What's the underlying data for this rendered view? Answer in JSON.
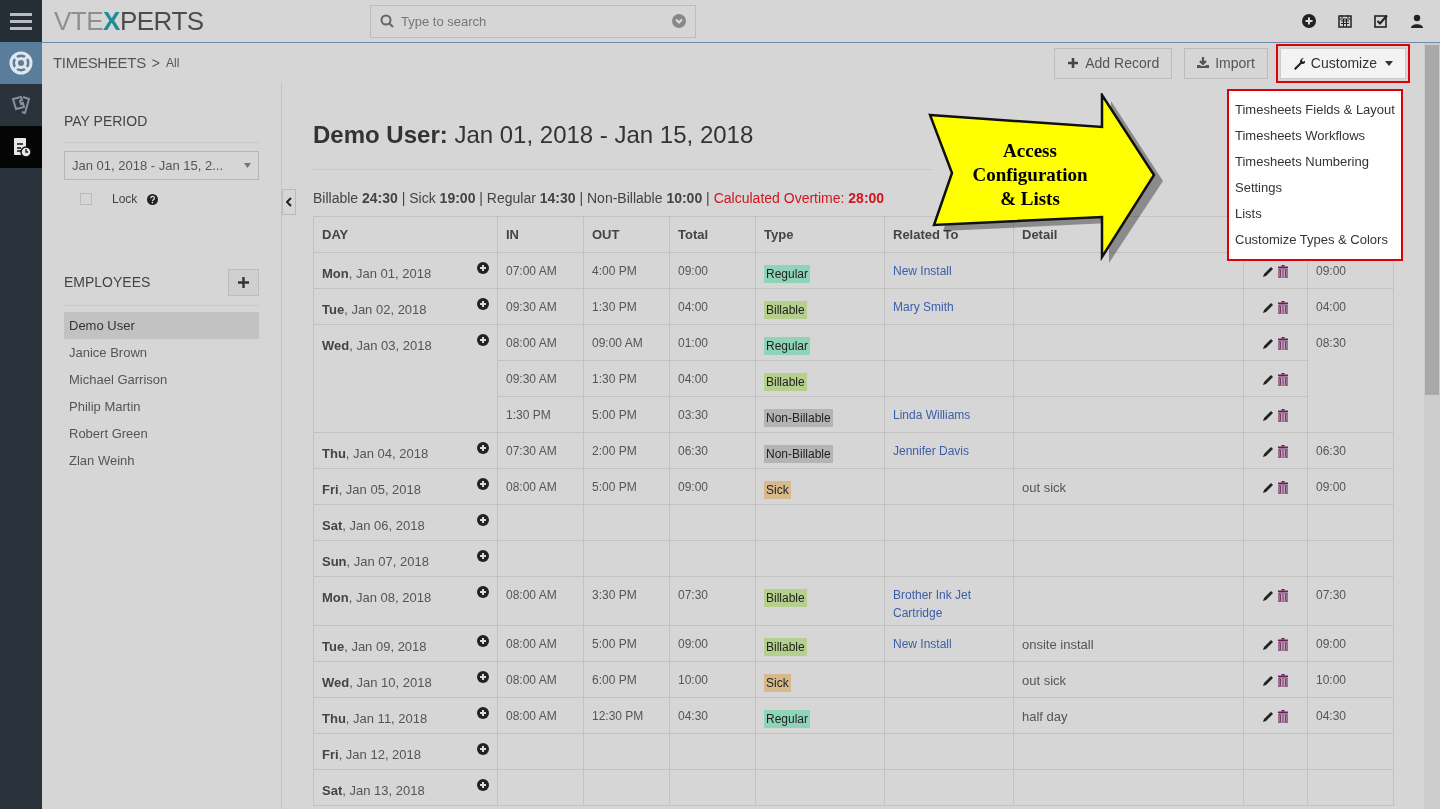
{
  "nav_rail": [
    {
      "selected": false
    },
    {
      "selected": false
    },
    {
      "selected": true
    }
  ],
  "logo": {
    "part_1": "VTE",
    "part_2": "X",
    "part_3": "PERTS"
  },
  "search": {
    "placeholder": "Type to search"
  },
  "breadcrumb": {
    "module": "TIMESHEETS",
    "separator": ">",
    "view": "All"
  },
  "toolbar": {
    "buttons": [
      {
        "label": "Add Record",
        "kind": "add",
        "highlighted": false
      },
      {
        "label": "Import",
        "kind": "import",
        "highlighted": false
      },
      {
        "label": "Customize",
        "kind": "customize",
        "highlighted": true
      }
    ]
  },
  "customize_menu": {
    "items": [
      "Timesheets Fields & Layout",
      "Timesheets Workflows",
      "Timesheets Numbering",
      "Settings",
      "Lists",
      "Customize Types & Colors"
    ]
  },
  "pay_period": {
    "heading": "PAY PERIOD",
    "value": "Jan 01, 2018 - Jan 15, 2...",
    "lock": {
      "label": "Lock",
      "checked": false
    }
  },
  "employees": {
    "heading": "EMPLOYEES",
    "items": [
      {
        "name": "Demo User",
        "selected": true
      },
      {
        "name": "Janice Brown",
        "selected": false
      },
      {
        "name": "Michael Garrison",
        "selected": false
      },
      {
        "name": "Philip Martin",
        "selected": false
      },
      {
        "name": "Robert Green",
        "selected": false
      },
      {
        "name": "Zlan Weinh",
        "selected": false
      }
    ]
  },
  "title": "**Demo User:** Jan 01, 2018 - Jan 15, 2018",
  "summary": "Billable **24:30** | Sick **19:00** | Regular **14:30** | Non-Billable **10:00** |",
  "overtime": "Calculated Overtime: **28:00**",
  "table": {
    "columns": [
      "DAY",
      "IN",
      "OUT",
      "Total",
      "Type",
      "Related To",
      "Detail"
    ],
    "days": [
      {
        "weekday": "Mon",
        "date": ", Jan 01, 2018",
        "total": "09:00",
        "entries": [
          {
            "in": "07:00 AM",
            "out": "4:00 PM",
            "total": "09:00",
            "type": "Regular",
            "color": "#8fd3b8",
            "related": "New Install"
          }
        ]
      },
      {
        "weekday": "Tue",
        "date": ", Jan 02, 2018",
        "total": "04:00",
        "entries": [
          {
            "in": "09:30 AM",
            "out": "1:30 PM",
            "total": "04:00",
            "type": "Billable",
            "color": "#b5cf8c",
            "related": "Mary Smith"
          }
        ]
      },
      {
        "weekday": "Wed",
        "date": ", Jan 03, 2018",
        "total": "08:30",
        "entries": [
          {
            "in": "08:00 AM",
            "out": "09:00 AM",
            "total": "01:00",
            "type": "Regular",
            "color": "#8fd3b8"
          },
          {
            "in": "09:30 AM",
            "out": "1:30 PM",
            "total": "04:00",
            "type": "Billable",
            "color": "#b5cf8c"
          },
          {
            "in": "1:30 PM",
            "out": "5:00 PM",
            "total": "03:30",
            "type": "Non-Billable",
            "color": "#b4b4b4",
            "related": "Linda Williams"
          }
        ]
      },
      {
        "weekday": "Thu",
        "date": ", Jan 04, 2018",
        "total": "06:30",
        "entries": [
          {
            "in": "07:30 AM",
            "out": "2:00 PM",
            "total": "06:30",
            "type": "Non-Billable",
            "color": "#b4b4b4",
            "related": "Jennifer Davis"
          }
        ]
      },
      {
        "weekday": "Fri",
        "date": ", Jan 05, 2018",
        "total": "09:00",
        "entries": [
          {
            "in": "08:00 AM",
            "out": "5:00 PM",
            "total": "09:00",
            "type": "Sick",
            "color": "#d8b98b",
            "detail": "out sick"
          }
        ]
      },
      {
        "weekday": "Sat",
        "date": ", Jan 06, 2018"
      },
      {
        "weekday": "Sun",
        "date": ", Jan 07, 2018"
      },
      {
        "weekday": "Mon",
        "date": ", Jan 08, 2018",
        "total": "07:30",
        "entries": [
          {
            "in": "08:00 AM",
            "out": "3:30 PM",
            "total": "07:30",
            "type": "Billable",
            "color": "#b5cf8c",
            "related": "Brother Ink Jet Cartridge"
          }
        ]
      },
      {
        "weekday": "Tue",
        "date": ", Jan 09, 2018",
        "total": "09:00",
        "entries": [
          {
            "in": "08:00 AM",
            "out": "5:00 PM",
            "total": "09:00",
            "type": "Billable",
            "color": "#b5cf8c",
            "related": "New Install",
            "detail": "onsite install"
          }
        ]
      },
      {
        "weekday": "Wed",
        "date": ", Jan 10, 2018",
        "total": "10:00",
        "entries": [
          {
            "in": "08:00 AM",
            "out": "6:00 PM",
            "total": "10:00",
            "type": "Sick",
            "color": "#d8b98b",
            "detail": "out sick"
          }
        ]
      },
      {
        "weekday": "Thu",
        "date": ", Jan 11, 2018",
        "total": "04:30",
        "entries": [
          {
            "in": "08:00 AM",
            "out": "12:30 PM",
            "total": "04:30",
            "type": "Regular",
            "color": "#8fd3b8",
            "detail": "half day"
          }
        ]
      },
      {
        "weekday": "Fri",
        "date": ", Jan 12, 2018"
      },
      {
        "weekday": "Sat",
        "date": ", Jan 13, 2018"
      }
    ]
  },
  "callout": {
    "lines": [
      "Access",
      "Configuration",
      "& Lists"
    ]
  }
}
